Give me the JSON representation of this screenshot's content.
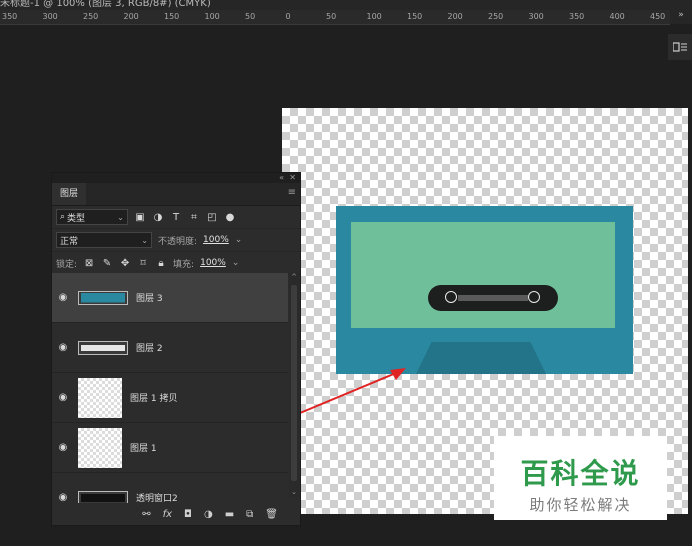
{
  "doc_title": "未标题-1 @ 100% (图层 3, RGB/8#) (CMYK)",
  "ruler": {
    "labels": [
      "350",
      "300",
      "250",
      "200",
      "150",
      "100",
      "50",
      "0",
      "50",
      "100",
      "150",
      "200",
      "250",
      "300",
      "350",
      "400",
      "450"
    ]
  },
  "layers_panel": {
    "tab": "图层",
    "filter": {
      "label": "类型",
      "icons": [
        "image-filter-icon",
        "adjustment-filter-icon",
        "text-filter-icon",
        "shape-filter-icon",
        "smart-object-filter-icon",
        "toggle-dot-icon"
      ]
    },
    "blend_mode": "正常",
    "opacity_label": "不透明度:",
    "opacity_value": "100%",
    "lock_label": "锁定:",
    "fill_label": "填充:",
    "fill_value": "100%",
    "layers": [
      {
        "name": "图层 3",
        "selected": true
      },
      {
        "name": "图层 2",
        "selected": false
      },
      {
        "name": "图层 1 拷贝",
        "selected": false
      },
      {
        "name": "图层 1",
        "selected": false
      },
      {
        "name": "透明窗口2",
        "selected": false
      }
    ]
  },
  "watermark": {
    "title": "百科全说",
    "subtitle": "助你轻松解决"
  },
  "colors": {
    "cassette_body": "#2a88a1",
    "cassette_label": "#6fc09a",
    "cassette_bottom": "#237389",
    "arrow": "#e02424",
    "watermark_green": "#2f9a4c"
  }
}
